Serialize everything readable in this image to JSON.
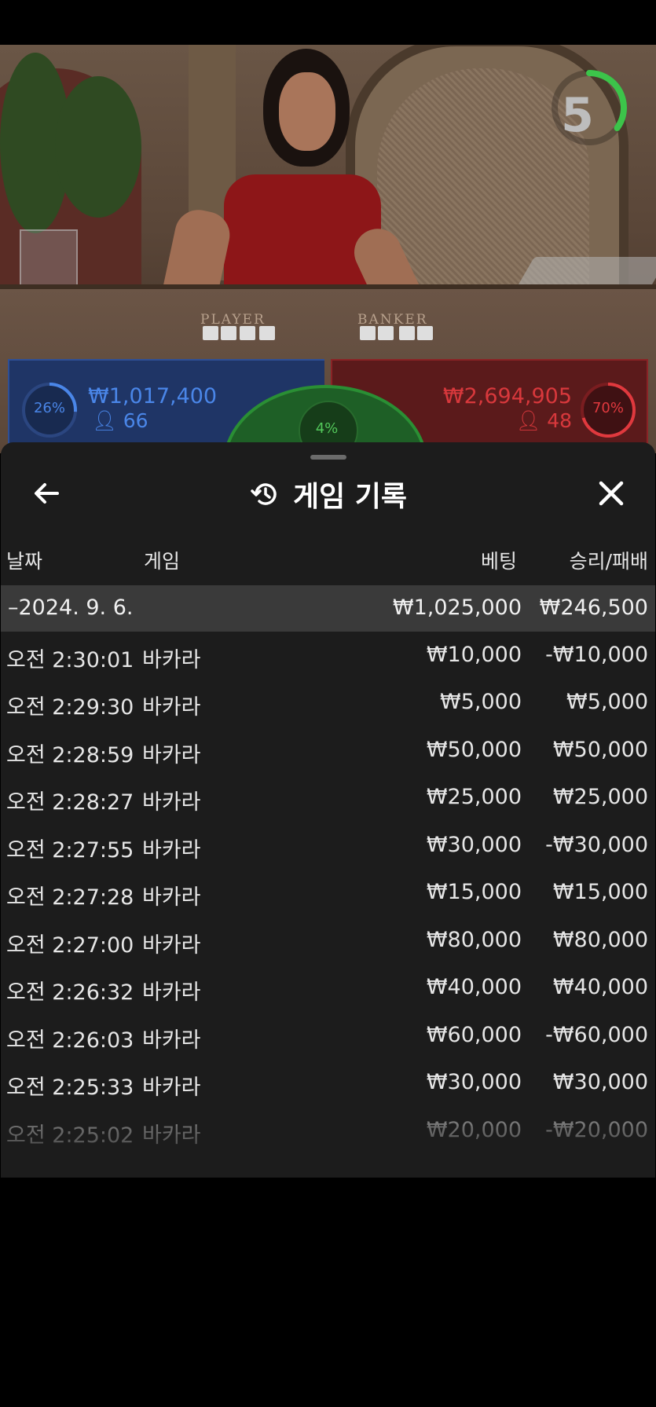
{
  "live": {
    "timer": "5",
    "timer_fraction": 0.35,
    "table_labels": {
      "player": "PLAYER",
      "banker": "BANKER"
    },
    "player_bet": {
      "percent": "26%",
      "amount": "₩1,017,400",
      "players": "66"
    },
    "banker_bet": {
      "percent": "70%",
      "amount": "₩2,694,905",
      "players": "48"
    },
    "tie_bet": {
      "percent": "4%"
    }
  },
  "history": {
    "title": "게임 기록",
    "icons": {
      "back": "arrow-left-icon",
      "history": "history-clock-icon",
      "close": "close-icon"
    },
    "columns": {
      "date": "날짜",
      "game": "게임",
      "bet": "베팅",
      "result": "승리/패배"
    },
    "date_group": {
      "label": "–2024. 9. 6.",
      "total_bet": "₩1,025,000",
      "total_result": "₩246,500"
    },
    "rows": [
      {
        "time": "오전 2:30:01",
        "game": "바카라",
        "bet": "₩10,000",
        "result": "-₩10,000"
      },
      {
        "time": "오전 2:29:30",
        "game": "바카라",
        "bet": "₩5,000",
        "result": "₩5,000"
      },
      {
        "time": "오전 2:28:59",
        "game": "바카라",
        "bet": "₩50,000",
        "result": "₩50,000"
      },
      {
        "time": "오전 2:28:27",
        "game": "바카라",
        "bet": "₩25,000",
        "result": "₩25,000"
      },
      {
        "time": "오전 2:27:55",
        "game": "바카라",
        "bet": "₩30,000",
        "result": "-₩30,000"
      },
      {
        "time": "오전 2:27:28",
        "game": "바카라",
        "bet": "₩15,000",
        "result": "₩15,000"
      },
      {
        "time": "오전 2:27:00",
        "game": "바카라",
        "bet": "₩80,000",
        "result": "₩80,000"
      },
      {
        "time": "오전 2:26:32",
        "game": "바카라",
        "bet": "₩40,000",
        "result": "₩40,000"
      },
      {
        "time": "오전 2:26:03",
        "game": "바카라",
        "bet": "₩60,000",
        "result": "-₩60,000"
      },
      {
        "time": "오전 2:25:33",
        "game": "바카라",
        "bet": "₩30,000",
        "result": "₩30,000"
      },
      {
        "time": "오전 2:25:02",
        "game": "바카라",
        "bet": "₩20,000",
        "result": "-₩20,000"
      }
    ]
  },
  "colors": {
    "player": "#2e4f96",
    "banker": "#8a2326",
    "tie": "#2a8f34",
    "sheet_bg": "#1c1c1c",
    "date_row_bg": "#3a3a3a"
  }
}
